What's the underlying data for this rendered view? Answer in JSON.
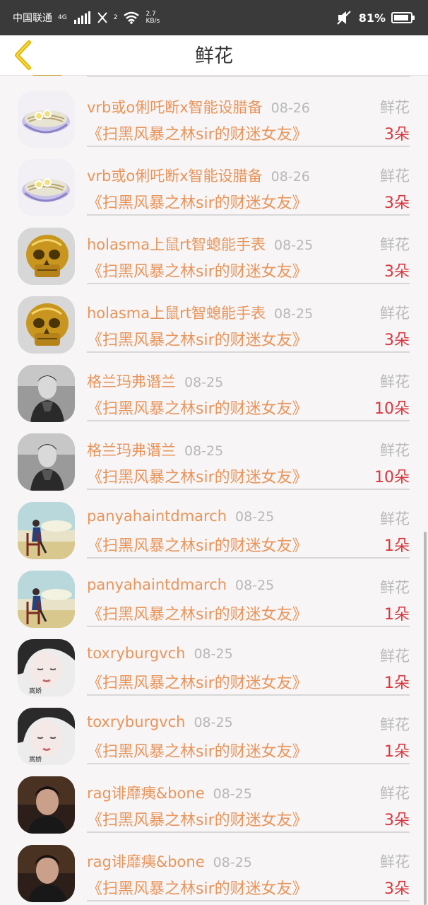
{
  "status_bar": {
    "carrier": "中国联通",
    "network": "4G",
    "sim2": "2",
    "speed_value": "2.7",
    "speed_unit": "KB/s",
    "battery": "81%"
  },
  "nav": {
    "title": "鲜花"
  },
  "list": {
    "items": [
      {
        "name": "vrb或o俐吒断x智能设腊备",
        "date": "08-26",
        "gift": "鲜花",
        "work": "《扫黑风暴之林sir的财迷女友》",
        "count": "3朵",
        "avatar_icon": "noodle-bowl-avatar"
      },
      {
        "name": "vrb或o俐吒断x智能设腊备",
        "date": "08-26",
        "gift": "鲜花",
        "work": "《扫黑风暴之林sir的财迷女友》",
        "count": "3朵",
        "avatar_icon": "noodle-bowl-avatar"
      },
      {
        "name": "holasma上鼠rt智螅能手表",
        "date": "08-25",
        "gift": "鲜花",
        "work": "《扫黑风暴之林sir的财迷女友》",
        "count": "3朵",
        "avatar_icon": "golden-skull-avatar"
      },
      {
        "name": "holasma上鼠rt智螅能手表",
        "date": "08-25",
        "gift": "鲜花",
        "work": "《扫黑风暴之林sir的财迷女友》",
        "count": "3朵",
        "avatar_icon": "golden-skull-avatar"
      },
      {
        "name": "格兰玛弗谮兰",
        "date": "08-25",
        "gift": "鲜花",
        "work": "《扫黑风暴之林sir的财迷女友》",
        "count": "10朵",
        "avatar_icon": "bw-portrait-avatar"
      },
      {
        "name": "格兰玛弗谮兰",
        "date": "08-25",
        "gift": "鲜花",
        "work": "《扫黑风暴之林sir的财迷女友》",
        "count": "10朵",
        "avatar_icon": "bw-portrait-avatar"
      },
      {
        "name": "panyahaintdmarch",
        "date": "08-25",
        "gift": "鲜花",
        "work": "《扫黑风暴之林sir的财迷女友》",
        "count": "1朵",
        "avatar_icon": "chair-sky-avatar"
      },
      {
        "name": "panyahaintdmarch",
        "date": "08-25",
        "gift": "鲜花",
        "work": "《扫黑风暴之林sir的财迷女友》",
        "count": "1朵",
        "avatar_icon": "chair-sky-avatar"
      },
      {
        "name": "toxryburgvch",
        "date": "08-25",
        "gift": "鲜花",
        "work": "《扫黑风暴之林sir的财迷女友》",
        "count": "1朵",
        "avatar_icon": "girl-face-avatar"
      },
      {
        "name": "toxryburgvch",
        "date": "08-25",
        "gift": "鲜花",
        "work": "《扫黑风暴之林sir的财迷女友》",
        "count": "1朵",
        "avatar_icon": "girl-face-avatar"
      },
      {
        "name": "rag诽靡痍&bone",
        "date": "08-25",
        "gift": "鲜花",
        "work": "《扫黑风暴之林sir的财迷女友》",
        "count": "3朵",
        "avatar_icon": "dark-portrait-avatar"
      },
      {
        "name": "rag诽靡痍&bone",
        "date": "08-25",
        "gift": "鲜花",
        "work": "《扫黑风暴之林sir的财迷女友》",
        "count": "3朵",
        "avatar_icon": "dark-portrait-avatar"
      }
    ]
  },
  "colors": {
    "accent_orange": "#e8955c",
    "count_red": "#d9363e",
    "back_arrow": "#e6b800",
    "status_bar_bg": "#3a3a3a"
  }
}
